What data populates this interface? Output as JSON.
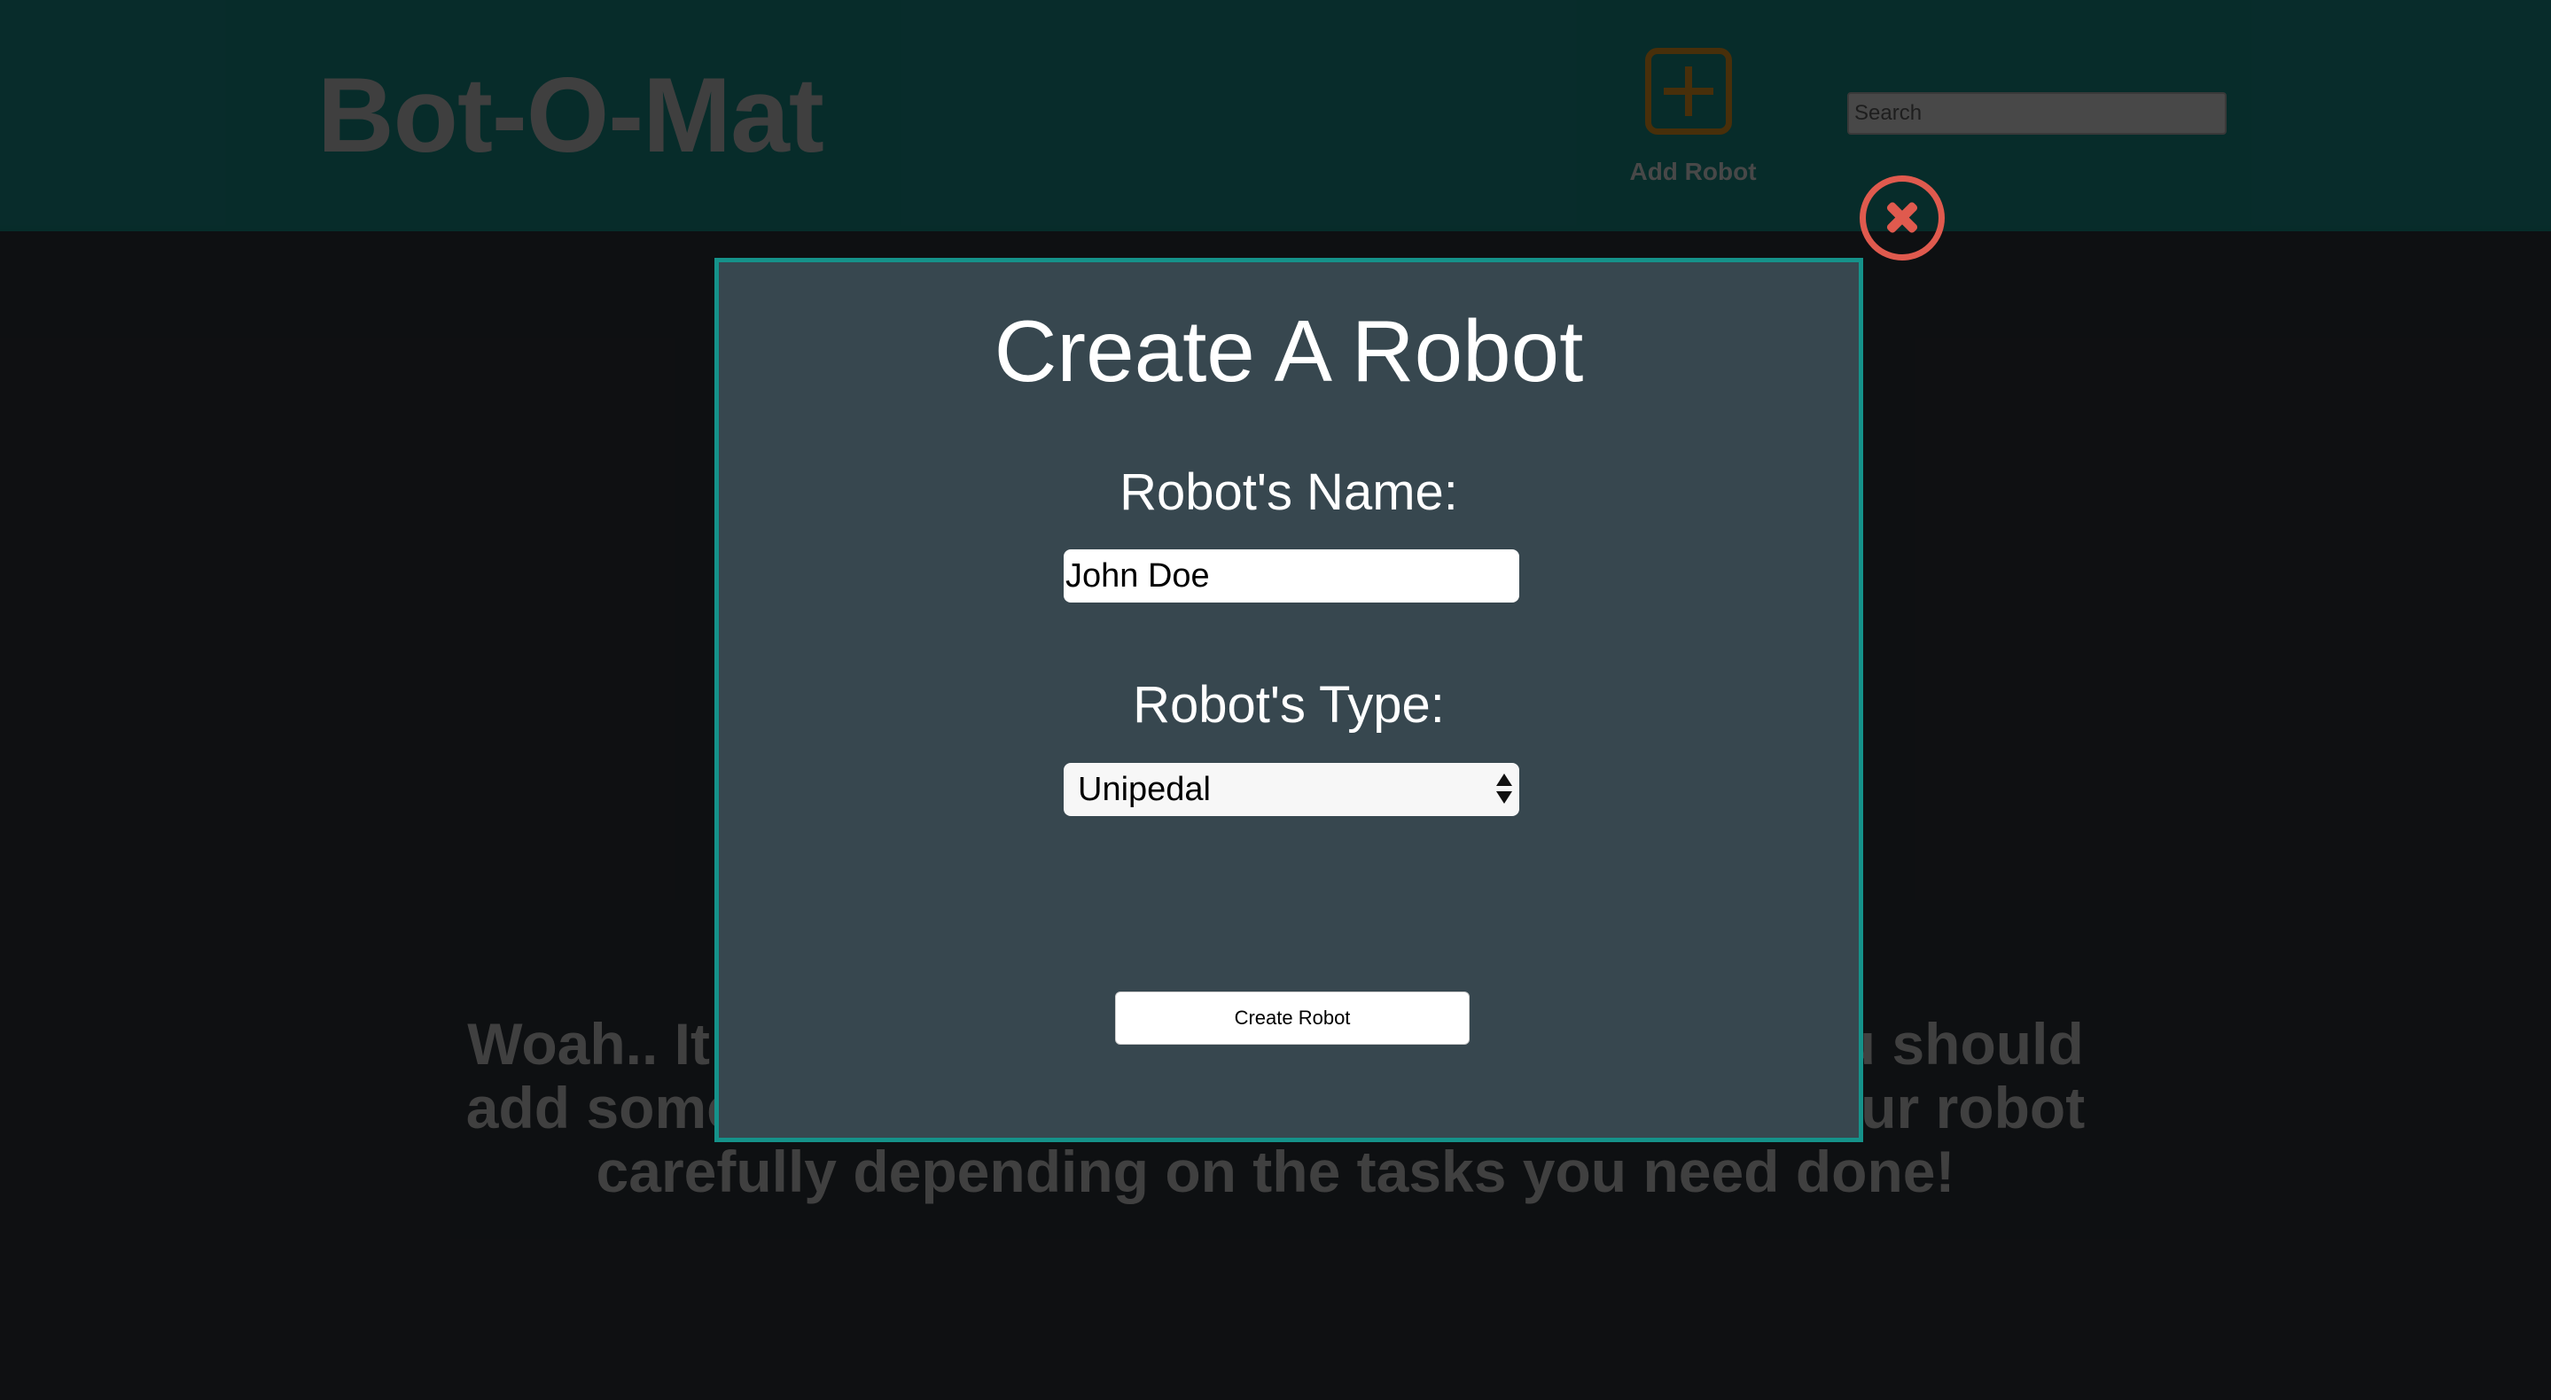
{
  "header": {
    "brand": "Bot-O-Mat",
    "add_robot_label": "Add Robot",
    "search_placeholder": "Search"
  },
  "main": {
    "empty_message": "Woah.. It looks like you don't have any robots! You should add some while they are free, so why not? Pick your robot carefully depending on the tasks you need done!"
  },
  "modal": {
    "title": "Create A Robot",
    "name_label": "Robot's Name:",
    "name_value": "John Doe",
    "type_label": "Robot's Type:",
    "type_value": "Unipedal",
    "submit_label": "Create Robot"
  },
  "colors": {
    "header_bg": "#0f5552",
    "modal_bg": "#37474f",
    "modal_border": "#15928a",
    "close_accent": "#e05a4e",
    "add_icon": "#8a5a14"
  },
  "icons": {
    "add": "plus-square-icon",
    "close": "close-circle-icon",
    "select": "select-arrows-icon"
  }
}
